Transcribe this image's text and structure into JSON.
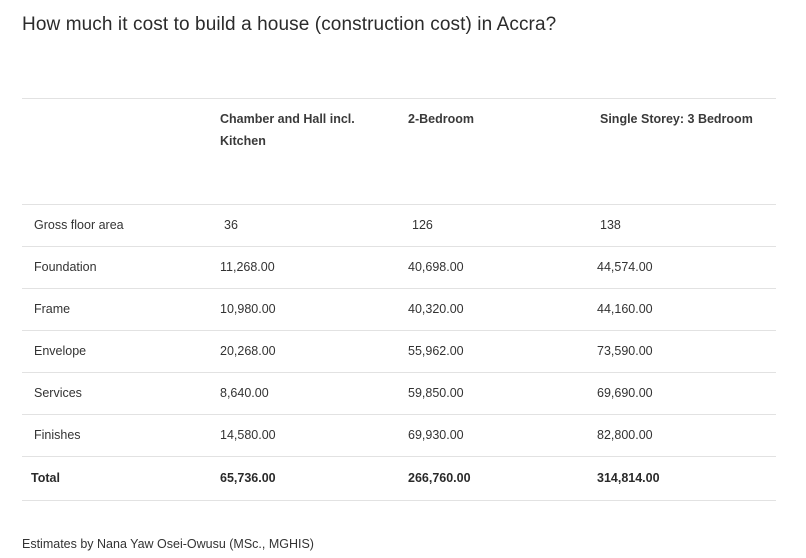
{
  "title": "How much it cost to build a house (construction cost) in Accra?",
  "table": {
    "headers": [
      "",
      "Chamber and Hall incl. Kitchen",
      "2-Bedroom",
      "Single Storey: 3 Bedroom"
    ],
    "rows": [
      {
        "label": "Gross floor area",
        "values": [
          "36",
          "126",
          "138"
        ]
      },
      {
        "label": "Foundation",
        "values": [
          "11,268.00",
          "40,698.00",
          "44,574.00"
        ]
      },
      {
        "label": "Frame",
        "values": [
          "10,980.00",
          "40,320.00",
          "44,160.00"
        ]
      },
      {
        "label": "Envelope",
        "values": [
          "20,268.00",
          "55,962.00",
          "73,590.00"
        ]
      },
      {
        "label": "Services",
        "values": [
          "8,640.00",
          "59,850.00",
          "69,690.00"
        ]
      },
      {
        "label": "Finishes",
        "values": [
          "14,580.00",
          "69,930.00",
          "82,800.00"
        ]
      }
    ],
    "total": {
      "label": "Total",
      "values": [
        "65,736.00",
        "266,760.00",
        "314,814.00"
      ]
    }
  },
  "footer": "Estimates by Nana Yaw Osei-Owusu (MSc., MGHIS)"
}
